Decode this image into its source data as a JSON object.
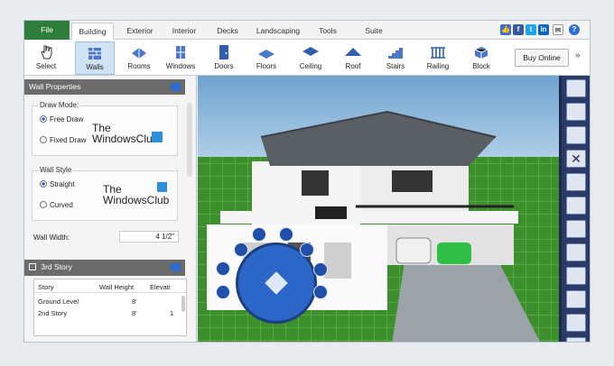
{
  "tabs": [
    "File",
    "Building",
    "Exterior",
    "Interior",
    "Decks",
    "Landscaping",
    "Tools",
    "Suite"
  ],
  "social": [
    "like-icon",
    "facebook-icon",
    "twitter-icon",
    "linkedin-icon",
    "email-icon",
    "help-icon"
  ],
  "ribbon": {
    "items": [
      {
        "label": "Select",
        "icon": "hand-pointer-icon"
      },
      {
        "label": "Walls",
        "icon": "walls-icon"
      },
      {
        "label": "Rooms",
        "icon": "rooms-icon"
      },
      {
        "label": "Windows",
        "icon": "windows-icon"
      },
      {
        "label": "Doors",
        "icon": "doors-icon"
      },
      {
        "label": "Floors",
        "icon": "floors-icon"
      },
      {
        "label": "Ceiling",
        "icon": "ceiling-icon"
      },
      {
        "label": "Roof",
        "icon": "roof-icon"
      },
      {
        "label": "Stairs",
        "icon": "stairs-icon"
      },
      {
        "label": "Railing",
        "icon": "railing-icon"
      },
      {
        "label": "Block",
        "icon": "block-icon"
      }
    ],
    "buy_label": "Buy Online",
    "more": "»"
  },
  "wall_properties": {
    "title": "Wall Properties",
    "draw_mode": {
      "title": "Draw Mode:",
      "options": [
        "Free Draw",
        "Fixed Draw"
      ]
    },
    "wall_style": {
      "title": "Wall Style",
      "options": [
        "Straight",
        "Curved"
      ]
    },
    "watermark": {
      "line1": "The",
      "line2": "WindowsClub"
    },
    "wall_width": {
      "label": "Wall Width:",
      "value": "4 1/2\""
    }
  },
  "story_panel": {
    "title": "3rd Story",
    "headers": [
      "Story",
      "Wall Height",
      "Elevati"
    ],
    "rows": [
      [
        "Ground Level",
        "8'",
        ""
      ],
      [
        "2nd Story",
        "8'",
        "1"
      ]
    ]
  },
  "view_toolbar": [
    "hand-icon",
    "undo-icon",
    "redo-icon",
    "close-icon",
    "page-icon",
    "box-view-icon",
    "terrain-icon",
    "compass-icon",
    "layers-icon",
    "grid-icon",
    "magnet-icon",
    "settings-icon"
  ]
}
